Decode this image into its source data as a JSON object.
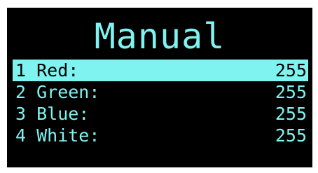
{
  "screen": {
    "title": "Manual",
    "menu": [
      {
        "label": "1 Red:",
        "value": "255",
        "selected": true
      },
      {
        "label": "2 Green:",
        "value": "255",
        "selected": false
      },
      {
        "label": "3 Blue:",
        "value": "255",
        "selected": false
      },
      {
        "label": "4 White:",
        "value": "255",
        "selected": false
      }
    ]
  },
  "colors": {
    "background": "#000000",
    "foreground": "#7ff3f0",
    "selection_background": "#7ff3f0",
    "selection_text": "#000000"
  }
}
